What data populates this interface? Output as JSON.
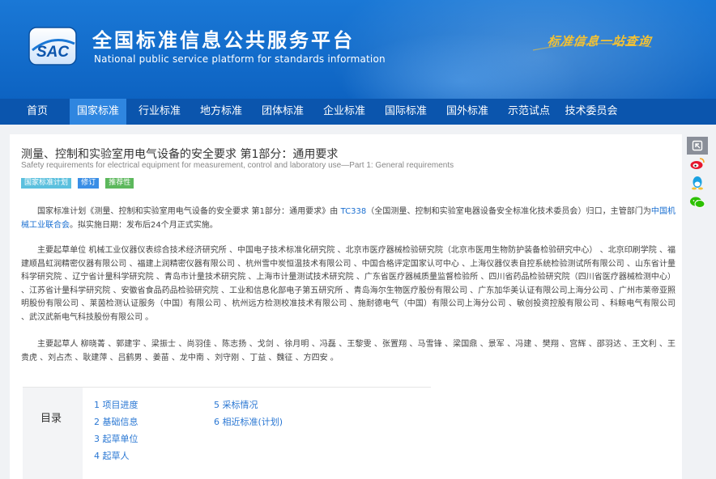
{
  "header": {
    "logo_text": "SAC",
    "title_cn": "全国标准信息公共服务平台",
    "title_en": "National public service platform  for standards information",
    "slogan": "标准信息一站查询"
  },
  "nav": {
    "items": [
      {
        "label": "首页"
      },
      {
        "label": "国家标准"
      },
      {
        "label": "行业标准"
      },
      {
        "label": "地方标准"
      },
      {
        "label": "团体标准"
      },
      {
        "label": "企业标准"
      },
      {
        "label": "国际标准"
      },
      {
        "label": "国外标准"
      },
      {
        "label": "示范试点"
      },
      {
        "label": "技术委员会"
      }
    ],
    "active_index": 1
  },
  "standard": {
    "title": "测量、控制和实验室用电气设备的安全要求 第1部分：通用要求",
    "subtitle": "Safety requirements for electrical equipment for measurement, control and laboratory use—Part 1: General requirements",
    "tags": [
      {
        "label": "国家标准计划",
        "color": "#5bc0de"
      },
      {
        "label": "修订",
        "color": "#3a8ee6"
      },
      {
        "label": "推荐性",
        "color": "#5cb85c"
      }
    ]
  },
  "intro": {
    "prefix": "国家标准计划《测量、控制和实验室用电气设备的安全要求 第1部分：通用要求》由 ",
    "tc_link": "TC338",
    "middle": "（全国测量、控制和实验室电器设备安全标准化技术委员会）归口，主管部门为",
    "dept_link": "中国机械工业联合会",
    "suffix": "。拟实施日期：发布后24个月正式实施。"
  },
  "drafting_units": {
    "text": "主要起草单位 机械工业仪器仪表综合技术经济研究所 、中国电子技术标准化研究院 、北京市医疗器械检验研究院（北京市医用生物防护装备检验研究中心） 、北京印刷学院 、福建顺昌虹润精密仪器有限公司 、福建上润精密仪器有限公司 、杭州雪中炭恒温技术有限公司 、中国合格评定国家认可中心 、上海仪器仪表自控系统检验测试所有限公司 、山东省计量科学研究院 、辽宁省计量科学研究院 、青岛市计量技术研究院 、上海市计量测试技术研究院 、广东省医疗器械质量监督检验所 、四川省药品检验研究院（四川省医疗器械检测中心） 、江苏省计量科学研究院 、安徽省食品药品检验研究院 、工业和信息化部电子第五研究所 、青岛海尔生物医疗股份有限公司 、广东加华美认证有限公司上海分公司 、广州市莱帝亚照明股份有限公司 、莱茵检测认证服务（中国）有限公司 、杭州远方检测校准技术有限公司 、施耐德电气（中国）有限公司上海分公司 、敏创投资控股有限公司 、科鲸电气有限公司 、武汉武新电气科技股份有限公司 。"
  },
  "drafters": {
    "text": "主要起草人 柳晓菁 、郭建宇 、梁振士 、尚羽佳 、陈志扬 、戈剑 、徐月明 、冯磊 、王黎雯 、张置翔 、马雪锋 、梁国鼎 、景军 、冯建 、樊翔 、宫辉 、邵羽达 、王文利 、王贵虎 、刘占杰 、耿建萍 、吕鹤男 、姜苗 、龙中南 、刘守刚 、丁益 、魏征 、方四安 。"
  },
  "toc": {
    "label": "目录",
    "items": [
      {
        "label": "1  项目进度"
      },
      {
        "label": "2  基础信息"
      },
      {
        "label": "3  起草单位"
      },
      {
        "label": "4  起草人"
      },
      {
        "label": "5  采标情况"
      },
      {
        "label": "6  相近标准(计划)"
      }
    ]
  },
  "share": {
    "icons": [
      "back-icon",
      "weibo-icon",
      "qq-icon",
      "wechat-icon"
    ],
    "colors": {
      "back": "#8a8f99",
      "weibo": "#e6162d",
      "qq": "#1aa1e1",
      "wechat": "#2dc100"
    }
  }
}
